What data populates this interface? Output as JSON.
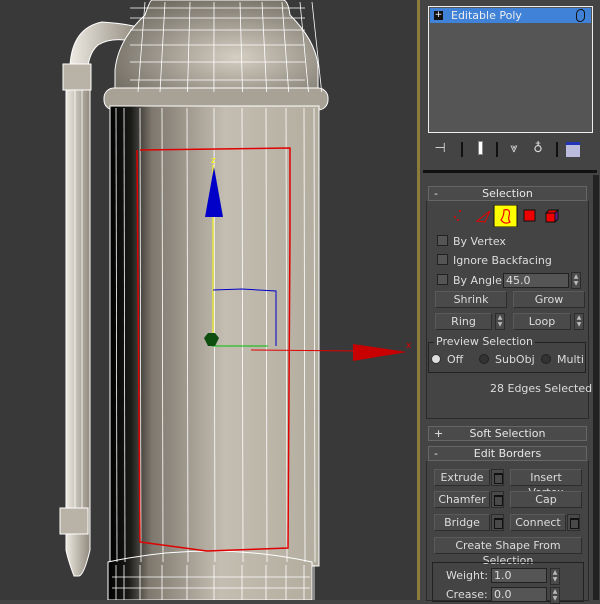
{
  "viewport": {
    "axis_x_label": "x",
    "axis_z_label": "z"
  },
  "modifier_stack": {
    "items": [
      {
        "label": "Editable Poly",
        "expanded": false,
        "selected": true
      }
    ]
  },
  "stack_toolbar": {
    "icons": [
      "pin-stack-icon",
      "show-end-result-icon",
      "make-unique-icon",
      "remove-modifier-icon",
      "configure-modifier-sets-icon"
    ]
  },
  "selection": {
    "title": "Selection",
    "collapse_sign": "-",
    "subobject_levels": [
      "vertex",
      "edge",
      "border",
      "polygon",
      "element"
    ],
    "active_level": "border",
    "by_vertex": {
      "label": "By Vertex",
      "checked": false
    },
    "ignore_backfacing": {
      "label": "Ignore Backfacing",
      "checked": false
    },
    "by_angle": {
      "label": "By Angle:",
      "checked": false,
      "value": "45.0"
    },
    "shrink": "Shrink",
    "grow": "Grow",
    "ring": "Ring",
    "loop": "Loop",
    "preview": {
      "title": "Preview Selection",
      "options": [
        "Off",
        "SubObj",
        "Multi"
      ],
      "selected": "Off"
    },
    "status": "28 Edges Selected"
  },
  "soft_selection": {
    "title": "Soft Selection",
    "sign": "+"
  },
  "edit_borders": {
    "title": "Edit Borders",
    "sign": "-",
    "extrude": "Extrude",
    "insert_vertex": "Insert Vertex",
    "chamfer": "Chamfer",
    "cap": "Cap",
    "bridge": "Bridge",
    "connect": "Connect",
    "create_shape": "Create Shape From Selection",
    "weight_label": "Weight:",
    "weight_value": "1.0",
    "crease_label": "Crease:",
    "crease_value": "0.0"
  },
  "colors": {
    "viewport_bg": "#393939",
    "selection": "#e00000",
    "active_level_bg": "#ffff00",
    "stack_selected": "#3f82d8"
  }
}
